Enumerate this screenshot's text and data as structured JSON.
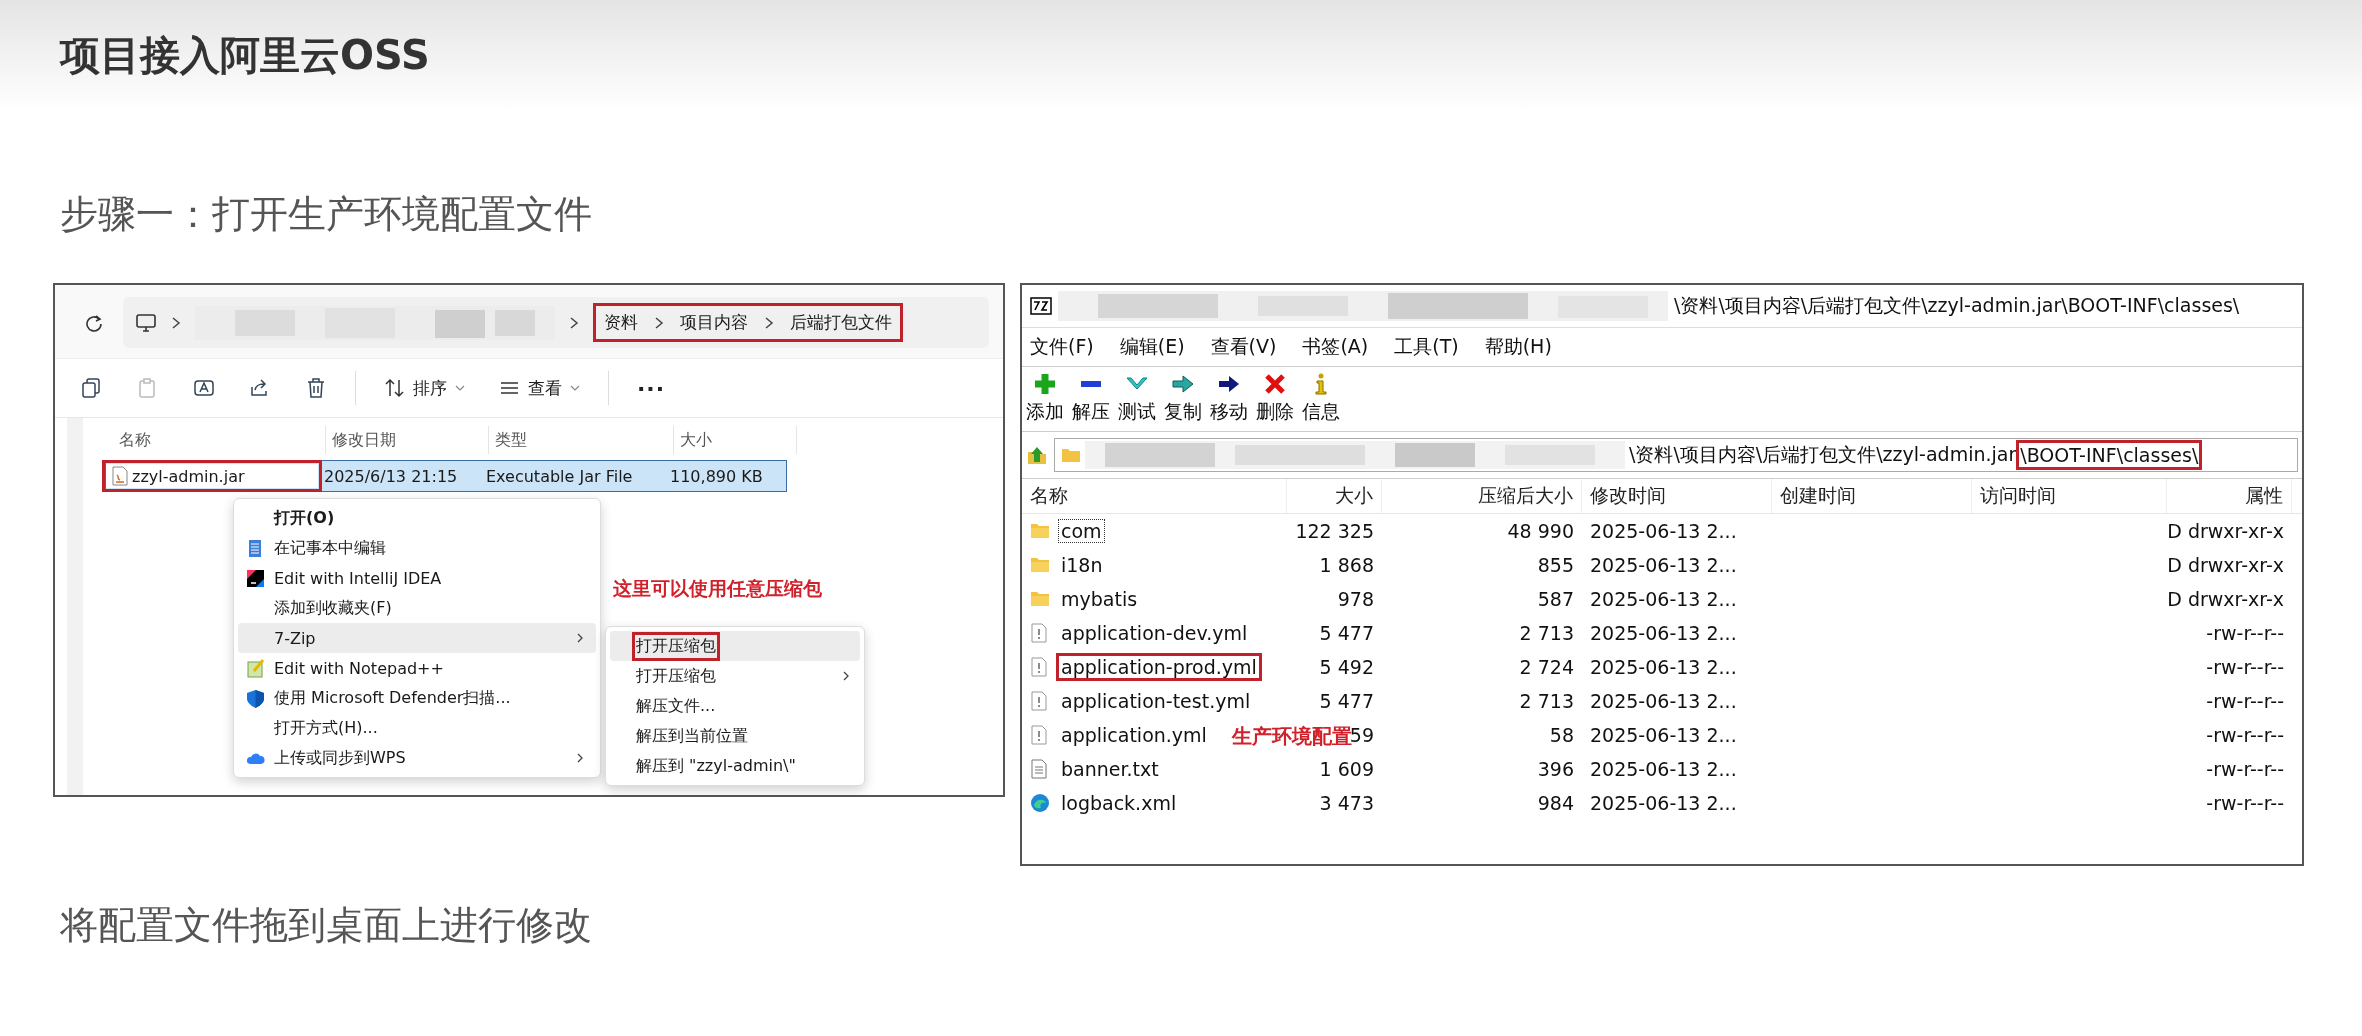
{
  "article": {
    "title": "项目接入阿里云OSS",
    "step": "步骤一：打开生产环境配置文件",
    "next_step": "将配置文件拖到桌面上进行修改"
  },
  "explorer": {
    "breadcrumb": [
      "资料",
      "项目内容",
      "后端打包文件"
    ],
    "breadcrumb_highlighted": true,
    "toolbar": [
      {
        "kind": "copy"
      },
      {
        "kind": "paste",
        "disabled": true
      },
      {
        "kind": "rename"
      },
      {
        "kind": "share"
      },
      {
        "kind": "delete"
      },
      {
        "kind": "sort",
        "label": "排序"
      },
      {
        "kind": "view",
        "label": "查看"
      },
      {
        "kind": "more",
        "label": "···"
      }
    ],
    "columns": [
      "名称",
      "修改日期",
      "类型",
      "大小"
    ],
    "file": {
      "name": "zzyl-admin.jar",
      "modified": "2025/6/13 21:15",
      "type": "Executable Jar File",
      "size": "110,890 KB",
      "selected": true,
      "highlighted": true
    },
    "context_menu": [
      {
        "label": "打开(O)",
        "kind": "plain",
        "bold": true,
        "hovered": false,
        "has_submenu": false
      },
      {
        "label": "在记事本中编辑",
        "kind": "notepad",
        "bold": false,
        "hovered": false,
        "has_submenu": false
      },
      {
        "label": "Edit with IntelliJ IDEA",
        "kind": "intellij",
        "bold": false,
        "hovered": false,
        "has_submenu": false
      },
      {
        "label": "添加到收藏夹(F)",
        "kind": "plain",
        "bold": false,
        "hovered": false,
        "has_submenu": false
      },
      {
        "label": "7-Zip",
        "kind": "plain",
        "bold": false,
        "hovered": true,
        "has_submenu": true
      },
      {
        "label": "Edit with Notepad++",
        "kind": "notepadpp",
        "bold": false,
        "hovered": false,
        "has_submenu": false
      },
      {
        "label": "使用 Microsoft Defender扫描...",
        "kind": "shield",
        "bold": false,
        "hovered": false,
        "has_submenu": false
      },
      {
        "label": "打开方式(H)...",
        "kind": "plain",
        "bold": false,
        "hovered": false,
        "has_submenu": false
      },
      {
        "label": "上传或同步到WPS",
        "kind": "cloud",
        "bold": false,
        "hovered": false,
        "has_submenu": true
      }
    ],
    "submenu": [
      {
        "label": "打开压缩包",
        "hovered": true,
        "highlighted": true,
        "has_submenu": false
      },
      {
        "label": "打开压缩包",
        "hovered": false,
        "highlighted": false,
        "has_submenu": true
      },
      {
        "label": "解压文件...",
        "hovered": false,
        "highlighted": false,
        "has_submenu": false
      },
      {
        "label": "解压到当前位置",
        "hovered": false,
        "highlighted": false,
        "has_submenu": false
      },
      {
        "label": "解压到 \"zzyl-admin\\\"",
        "hovered": false,
        "highlighted": false,
        "has_submenu": false
      }
    ],
    "annotation": "这里可以使用任意压缩包"
  },
  "archiver": {
    "title_path": "\\资料\\项目内容\\后端打包文件\\zzyl-admin.jar\\BOOT-INF\\classes\\",
    "menu": [
      "文件(F)",
      "编辑(E)",
      "查看(V)",
      "书签(A)",
      "工具(T)",
      "帮助(H)"
    ],
    "toolbar": [
      {
        "kind": "add",
        "label": "添加"
      },
      {
        "kind": "extract",
        "label": "解压"
      },
      {
        "kind": "test",
        "label": "测试"
      },
      {
        "kind": "copy",
        "label": "复制"
      },
      {
        "kind": "move",
        "label": "移动"
      },
      {
        "kind": "delete",
        "label": "删除"
      },
      {
        "kind": "info",
        "label": "信息"
      }
    ],
    "address": {
      "path": "\\资料\\项目内容\\后端打包文件\\zzyl-admin.jar",
      "highlighted_path": "\\BOOT-INF\\classes\\"
    },
    "columns": [
      "名称",
      "大小",
      "压缩后大小",
      "修改时间",
      "创建时间",
      "访问时间",
      "属性"
    ],
    "rows": [
      {
        "kind": "folder",
        "name": "com",
        "size": "122 325",
        "packed": "48 990",
        "modified": "2025-06-13 2...",
        "attributes": "D drwxr-xr-x",
        "focused": true,
        "highlighted": false
      },
      {
        "kind": "folder",
        "name": "i18n",
        "size": "1 868",
        "packed": "855",
        "modified": "2025-06-13 2...",
        "attributes": "D drwxr-xr-x",
        "focused": false,
        "highlighted": false
      },
      {
        "kind": "folder",
        "name": "mybatis",
        "size": "978",
        "packed": "587",
        "modified": "2025-06-13 2...",
        "attributes": "D drwxr-xr-x",
        "focused": false,
        "highlighted": false
      },
      {
        "kind": "config",
        "name": "application-dev.yml",
        "size": "5 477",
        "packed": "2 713",
        "modified": "2025-06-13 2...",
        "attributes": "-rw-r--r--",
        "focused": false,
        "highlighted": false
      },
      {
        "kind": "config",
        "name": "application-prod.yml",
        "size": "5 492",
        "packed": "2 724",
        "modified": "2025-06-13 2...",
        "attributes": "-rw-r--r--",
        "focused": false,
        "highlighted": true
      },
      {
        "kind": "config",
        "name": "application-test.yml",
        "size": "5 477",
        "packed": "2 713",
        "modified": "2025-06-13 2...",
        "attributes": "-rw-r--r--",
        "focused": false,
        "highlighted": false
      },
      {
        "kind": "config",
        "name": "application.yml",
        "size": "59",
        "packed": "58",
        "modified": "2025-06-13 2...",
        "attributes": "-rw-r--r--",
        "focused": false,
        "highlighted": false
      },
      {
        "kind": "text",
        "name": "banner.txt",
        "size": "1 609",
        "packed": "396",
        "modified": "2025-06-13 2...",
        "attributes": "-rw-r--r--",
        "focused": false,
        "highlighted": false
      },
      {
        "kind": "xml",
        "name": "logback.xml",
        "size": "3 473",
        "packed": "984",
        "modified": "2025-06-13 2...",
        "attributes": "-rw-r--r--",
        "focused": false,
        "highlighted": false
      }
    ],
    "annotation": "生产环境配置"
  }
}
